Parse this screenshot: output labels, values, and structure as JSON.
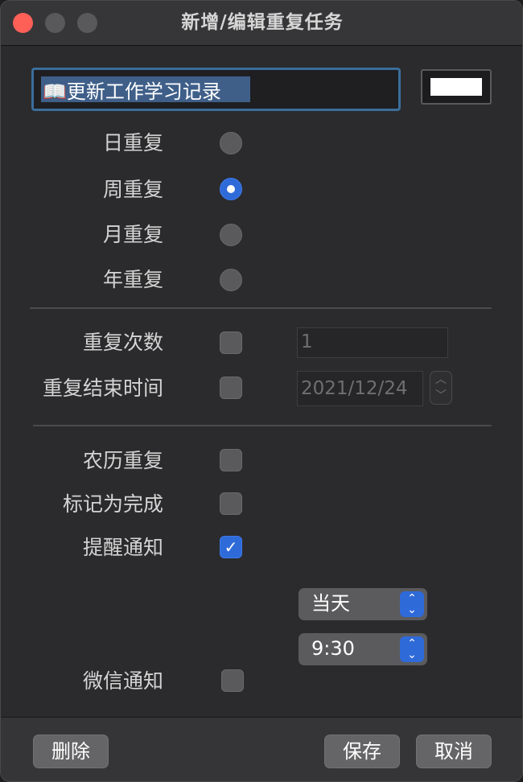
{
  "window": {
    "title": "新增/编辑重复任务"
  },
  "task": {
    "icon": "📖",
    "name": "更新工作学习记录",
    "color": "#ffffff"
  },
  "repeat_type": {
    "options": [
      {
        "label": "日重复",
        "selected": false
      },
      {
        "label": "周重复",
        "selected": true
      },
      {
        "label": "月重复",
        "selected": false
      },
      {
        "label": "年重复",
        "selected": false
      }
    ]
  },
  "repeat_limits": {
    "count_label": "重复次数",
    "count_checked": false,
    "count_value": "1",
    "end_label": "重复结束时间",
    "end_checked": false,
    "end_date": "2021/12/24"
  },
  "options": {
    "lunar_label": "农历重复",
    "lunar_checked": false,
    "complete_label": "标记为完成",
    "complete_checked": false,
    "remind_label": "提醒通知",
    "remind_checked": true,
    "remind_day": "当天",
    "remind_time": "9:30",
    "wechat_label": "微信通知",
    "wechat_checked": false
  },
  "footer": {
    "delete_label": "删除",
    "save_label": "保存",
    "cancel_label": "取消"
  },
  "colors": {
    "accent": "#2f6ad9",
    "close": "#fe5f57"
  }
}
